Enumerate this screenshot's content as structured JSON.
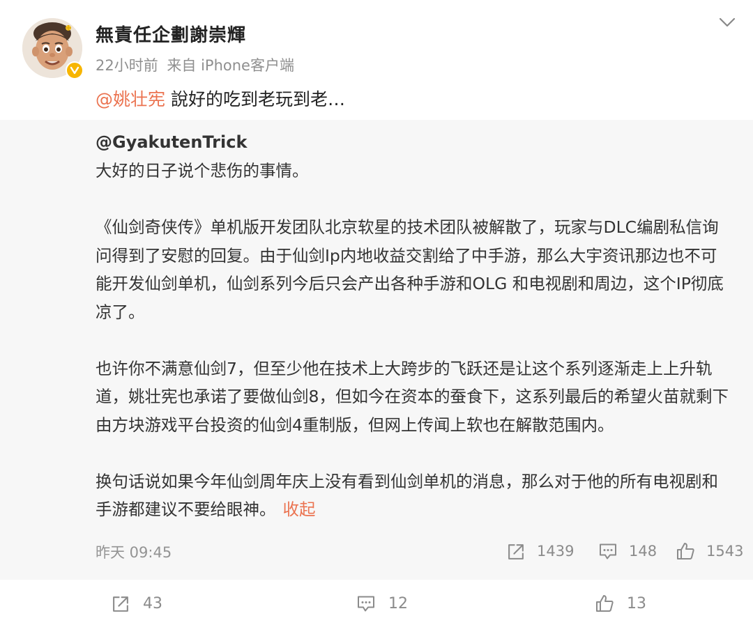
{
  "post": {
    "author": "無責任企劃謝崇輝",
    "time": "22小时前",
    "source": "来自 iPhone客户端",
    "mention": "@姚壮宪",
    "comment": " 說好的吃到老玩到老…"
  },
  "repost": {
    "author": "@GyakutenTrick",
    "lines": [
      "大好的日子说个悲伤的事情。",
      "",
      "《仙剑奇侠传》单机版开发团队北京软星的技术团队被解散了，玩家与DLC编剧私信询",
      "问得到了安慰的回复。由于仙剑Ip内地收益交割给了中手游，那么大宇资讯那边也不可",
      "能开发仙剑单机，仙剑系列今后只会产出各种手游和OLG 和电视剧和周边，这个IP彻底",
      "凉了。",
      "",
      "也许你不满意仙剑7，但至少他在技术上大跨步的飞跃还是让这个系列逐渐走上上升轨",
      "道，姚壮宪也承诺了要做仙剑8，但如今在资本的蚕食下，这系列最后的希望火苗就剩下",
      "由方块游戏平台投资的仙剑4重制版，但网上传闻上软也在解散范围内。",
      "",
      "换句话说如果今年仙剑周年庆上没有看到仙剑单机的消息，那么对于他的所有电视剧和"
    ],
    "last_line": "手游都建议不要给眼神。",
    "collapse": "收起",
    "time": "昨天 09:45",
    "reposts": "1439",
    "comments": "148",
    "likes": "1543"
  },
  "footer": {
    "reposts": "43",
    "comments": "12",
    "likes": "13"
  },
  "icons": {
    "more": "chevron-down-icon",
    "verified": "verified-badge-icon",
    "repost": "share-arrow-icon",
    "comment": "comment-bubble-icon",
    "like": "thumbs-up-icon"
  },
  "colors": {
    "accent": "#eb7350",
    "verified": "#f7b500",
    "repost_bg": "#f7f7f7",
    "meta_text": "#8f8f8f"
  }
}
